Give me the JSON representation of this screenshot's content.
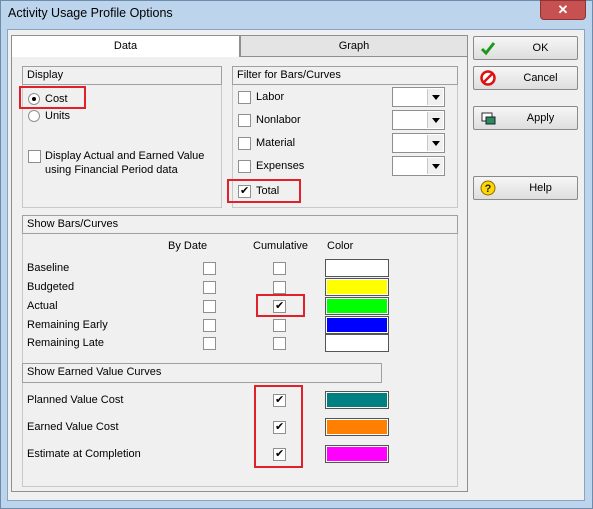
{
  "window": {
    "title": "Activity Usage Profile Options",
    "close_glyph": "✕"
  },
  "tabs": [
    {
      "label": "Data"
    },
    {
      "label": "Graph"
    }
  ],
  "display": {
    "header": "Display",
    "options": [
      {
        "label": "Cost",
        "selected": true
      },
      {
        "label": "Units",
        "selected": false
      }
    ],
    "financial_line1": "Display Actual and Earned Value",
    "financial_line2": "using Financial Period data"
  },
  "filter": {
    "header": "Filter for Bars/Curves",
    "items": [
      {
        "label": "Labor",
        "checked": false
      },
      {
        "label": "Nonlabor",
        "checked": false
      },
      {
        "label": "Material",
        "checked": false
      },
      {
        "label": "Expenses",
        "checked": false
      },
      {
        "label": "Total",
        "checked": true
      }
    ]
  },
  "bars": {
    "header": "Show Bars/Curves",
    "col_bydate": "By Date",
    "col_cumulative": "Cumulative",
    "col_color": "Color",
    "rows": [
      {
        "label": "Baseline",
        "bydate": false,
        "cumulative": false,
        "color": "#ffffff"
      },
      {
        "label": "Budgeted",
        "bydate": false,
        "cumulative": false,
        "color": "#ffff00"
      },
      {
        "label": "Actual",
        "bydate": false,
        "cumulative": true,
        "color": "#00ff00"
      },
      {
        "label": "Remaining Early",
        "bydate": false,
        "cumulative": false,
        "color": "#0000ff"
      },
      {
        "label": "Remaining Late",
        "bydate": false,
        "cumulative": false,
        "color": "#ffffff"
      }
    ]
  },
  "earned": {
    "header": "Show Earned Value Curves",
    "rows": [
      {
        "label": "Planned Value Cost",
        "checked": true,
        "color": "#008080"
      },
      {
        "label": "Earned Value Cost",
        "checked": true,
        "color": "#ff8000"
      },
      {
        "label": "Estimate at Completion",
        "checked": true,
        "color": "#ff00ff"
      }
    ]
  },
  "buttons": {
    "ok": {
      "label": "OK",
      "icon": "checkmark-icon"
    },
    "cancel": {
      "label": "Cancel",
      "icon": "cancel-icon"
    },
    "apply": {
      "label": "Apply",
      "icon": "apply-icon"
    },
    "help": {
      "label": "Help",
      "icon": "help-icon"
    }
  }
}
